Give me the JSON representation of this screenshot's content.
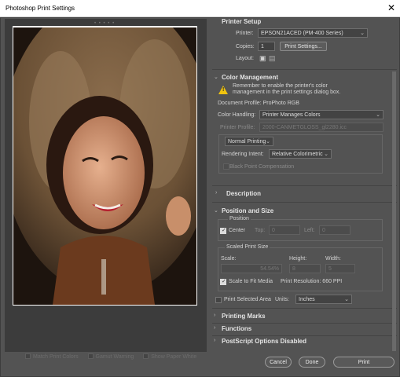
{
  "window": {
    "title": "Photoshop Print Settings",
    "close_glyph": "✕"
  },
  "preview": {
    "crop_marks": "• • • • •"
  },
  "bottom_options": [
    {
      "label": "Match Print Colors"
    },
    {
      "label": "Gamut Warning"
    },
    {
      "label": "Show Paper White"
    }
  ],
  "printer_setup": {
    "header": "Printer Setup",
    "printer_label": "Printer:",
    "printer_value": "EPSON21ACED (PM-400 Series)",
    "copies_label": "Copies:",
    "copies_value": "1",
    "print_settings_button": "Print Settings...",
    "layout_label": "Layout:"
  },
  "color_management": {
    "header": "Color Management",
    "warning_text_1": "Remember to enable the printer's color",
    "warning_text_2": "management in the print settings dialog box.",
    "document_profile": "Document Profile: ProPhoto RGB",
    "color_handling_label": "Color Handling:",
    "color_handling_value": "Printer Manages Colors",
    "printer_profile_label": "Printer Profile:",
    "printer_profile_value": "2000-CANMETGLOSS_gl2280.icc",
    "normal_printing": "Normal Printing",
    "rendering_intent_label": "Rendering Intent:",
    "rendering_intent_value": "Relative Colorimetric",
    "black_point": "Black Point Compensation"
  },
  "description": {
    "header": "Description"
  },
  "position_size": {
    "header": "Position and Size",
    "position_label": "Position",
    "center_label": "Center",
    "top_label": "Top:",
    "top_value": "0",
    "left_label": "Left:",
    "left_value": "0",
    "scaled_label": "Scaled Print Size",
    "scale_label": "Scale:",
    "height_label": "Height:",
    "width_label": "Width:",
    "scale_value": "54.54%",
    "height_value": "8",
    "width_value": "5",
    "fit_media_label": "Scale to Fit Media",
    "resolution": "Print Resolution: 660 PPI",
    "print_selected_area": "Print Selected Area",
    "units_label": "Units:",
    "units_value": "Inches"
  },
  "sections": {
    "printing_marks": "Printing Marks",
    "functions": "Functions",
    "postscript": "PostScript Options Disabled"
  },
  "footer": {
    "cancel": "Cancel",
    "done": "Done",
    "print": "Print"
  },
  "colors": {
    "accent_warning": "#f1c40f",
    "panel": "#535353"
  }
}
